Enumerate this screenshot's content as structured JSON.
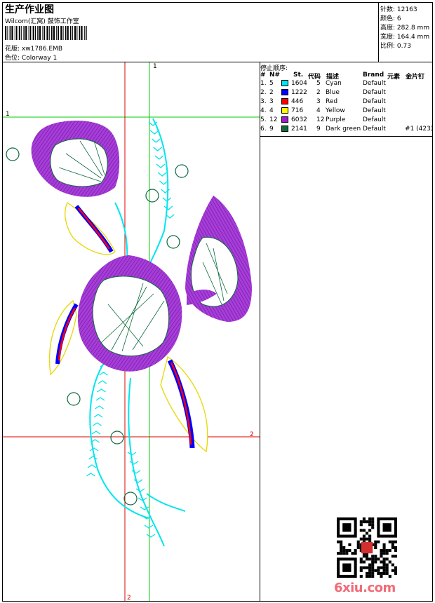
{
  "header": {
    "title": "生产作业图",
    "vendor": "Wilcom(汇窝) 鼓饰工作室",
    "design_label": "花版:",
    "design_value": "xw1786.EMB",
    "colorway_label": "色位:",
    "colorway_value": "Colorway 1"
  },
  "stats": [
    {
      "label": "针数:",
      "value": "12163"
    },
    {
      "label": "颜色:",
      "value": "6"
    },
    {
      "label": "高度:",
      "value": "282.8 mm"
    },
    {
      "label": "宽度:",
      "value": "164.4 mm"
    },
    {
      "label": "比例:",
      "value": "0.73"
    }
  ],
  "stops": {
    "title": "停止顺序:",
    "headers": {
      "num": "#",
      "n": "N#",
      "st": "St.",
      "code": "代码",
      "desc": "描述",
      "brand": "Brand",
      "elements": "元素",
      "sequins": "金片钉"
    },
    "rows": [
      {
        "num": "1.",
        "n": "5",
        "color": "#00e5ee",
        "st": "1604",
        "code": "5",
        "desc": "Cyan",
        "brand": "Default",
        "sequins": ""
      },
      {
        "num": "2.",
        "n": "2",
        "color": "#0000ff",
        "st": "1222",
        "code": "2",
        "desc": "Blue",
        "brand": "Default",
        "sequins": ""
      },
      {
        "num": "3.",
        "n": "3",
        "color": "#ff0000",
        "st": "446",
        "code": "3",
        "desc": "Red",
        "brand": "Default",
        "sequins": ""
      },
      {
        "num": "4.",
        "n": "4",
        "color": "#ffff00",
        "st": "716",
        "code": "4",
        "desc": "Yellow",
        "brand": "Default",
        "sequins": ""
      },
      {
        "num": "5.",
        "n": "12",
        "color": "#9b1fc8",
        "st": "6032",
        "code": "12",
        "desc": "Purple",
        "brand": "Default",
        "sequins": ""
      },
      {
        "num": "6.",
        "n": "9",
        "color": "#0b6b3a",
        "st": "2141",
        "code": "9",
        "desc": "Dark green",
        "brand": "Default",
        "sequins": "#1 (423)"
      }
    ]
  },
  "guides": {
    "green_label": "1",
    "red_label": "2"
  },
  "colors": {
    "cyan": "#00e5ee",
    "blue": "#0000ff",
    "red": "#ff0000",
    "yellow": "#ffff00",
    "purple": "#9b1fc8",
    "green": "#0b6b3a",
    "guide_green": "#00cc00",
    "guide_red": "#dd0000"
  },
  "watermark": "6xiu.com"
}
